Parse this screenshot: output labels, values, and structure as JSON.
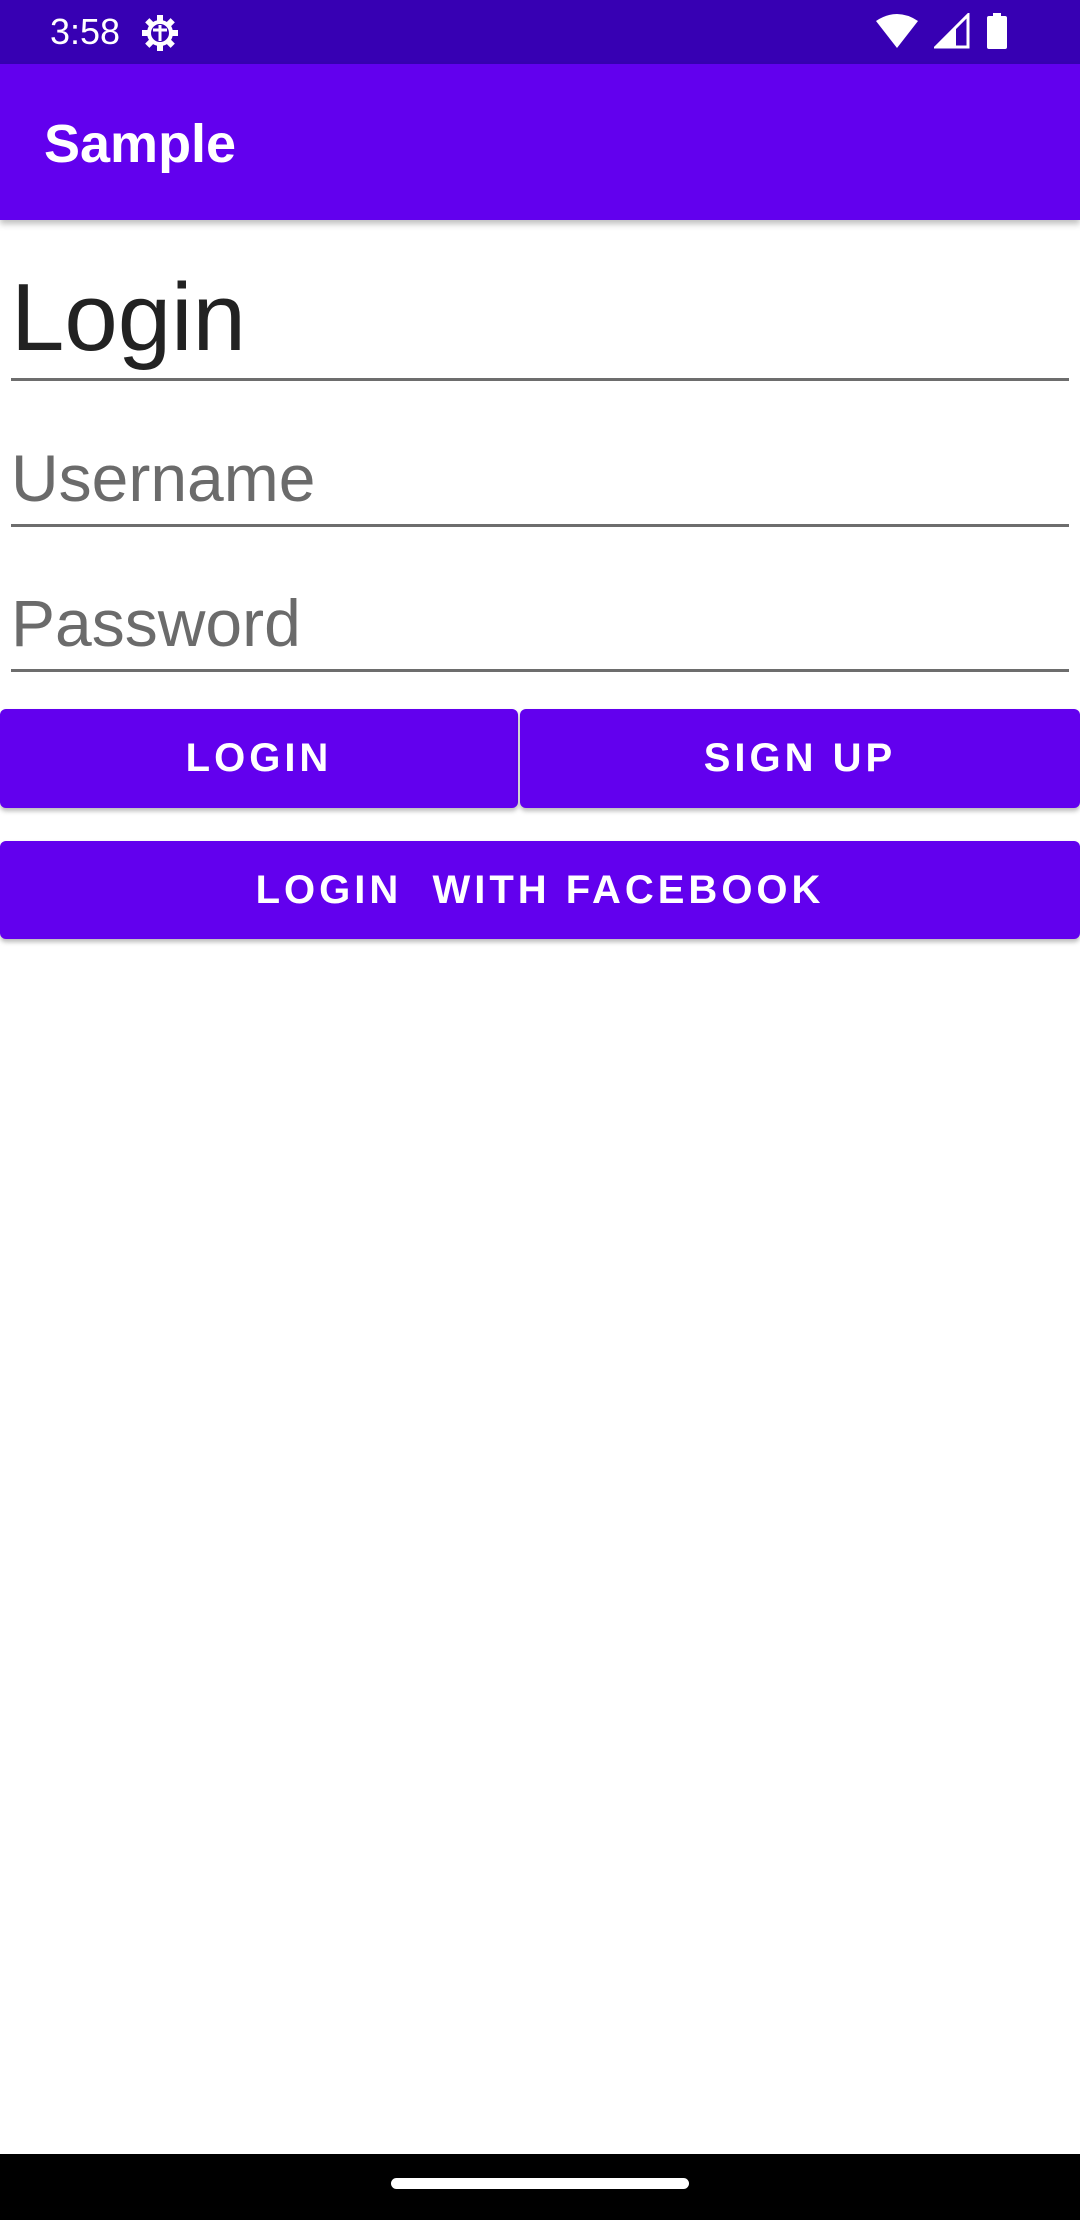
{
  "status_bar": {
    "time": "3:58",
    "icons": [
      "settings-gear-icon",
      "wifi-icon",
      "cellular-signal-icon",
      "battery-icon"
    ],
    "background_color": "#3700b3"
  },
  "app_bar": {
    "title": "Sample",
    "background_color": "#6200ee"
  },
  "form": {
    "heading": "Login",
    "username": {
      "value": "",
      "placeholder": "Username"
    },
    "password": {
      "value": "",
      "placeholder": "Password"
    }
  },
  "buttons": {
    "login_label": "LOGIN",
    "signup_label": "SIGN UP",
    "facebook_label": "LOGIN  WITH FACEBOOK",
    "color": "#6200ee"
  },
  "nav_bar": {
    "icons": [
      "home-handle"
    ]
  }
}
